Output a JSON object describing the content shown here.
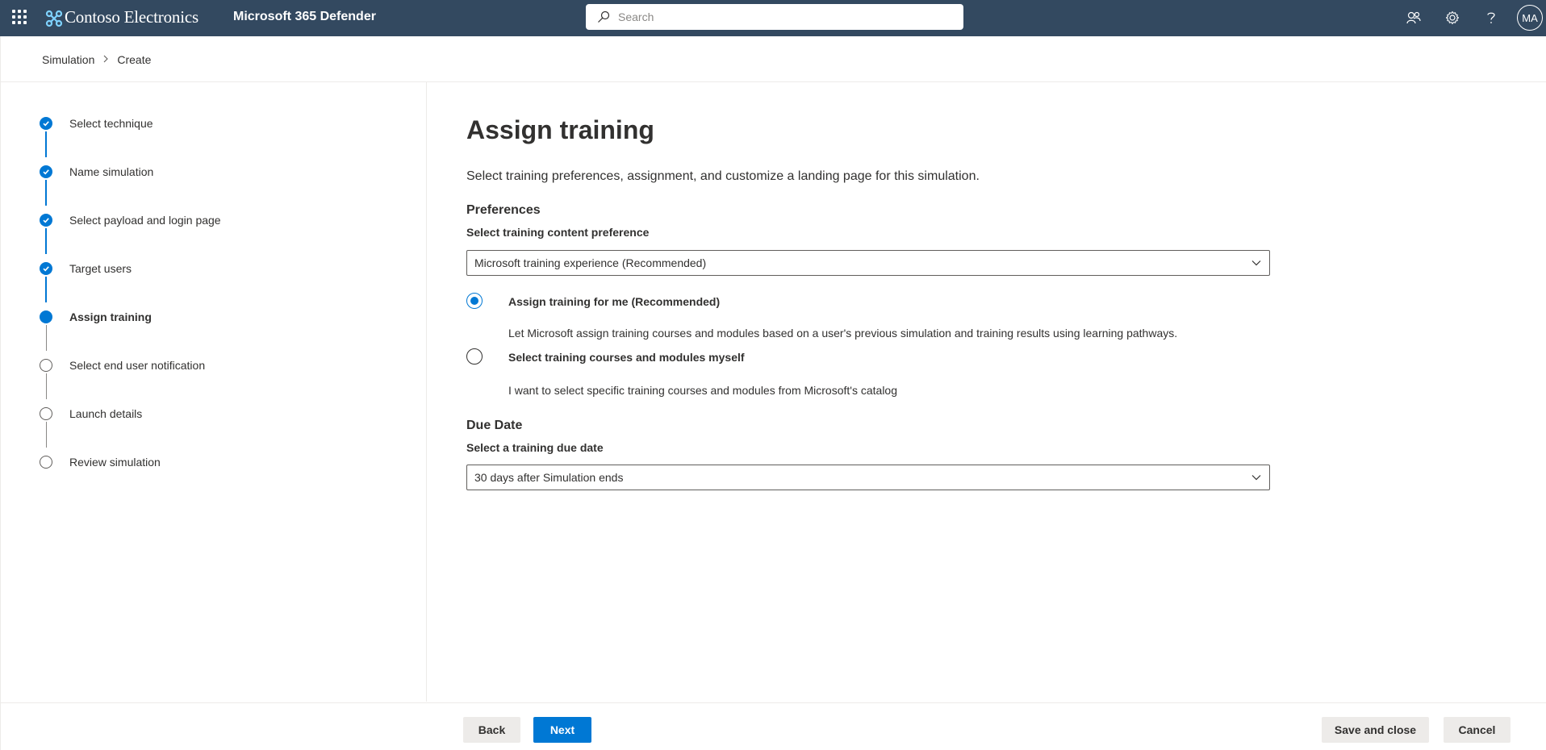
{
  "header": {
    "brand_name": "Contoso Electronics",
    "product_name": "Microsoft 365 Defender",
    "search_placeholder": "Search",
    "avatar_initials": "MA",
    "icons": [
      "app-launcher-icon",
      "community-icon",
      "gear-icon",
      "help-icon"
    ]
  },
  "breadcrumb": {
    "items": [
      "Simulation",
      "Create"
    ]
  },
  "steps": [
    {
      "label": "Select technique",
      "state": "done"
    },
    {
      "label": "Name simulation",
      "state": "done"
    },
    {
      "label": "Select payload and login page",
      "state": "done"
    },
    {
      "label": "Target users",
      "state": "done"
    },
    {
      "label": "Assign training",
      "state": "current"
    },
    {
      "label": "Select end user notification",
      "state": "todo"
    },
    {
      "label": "Launch details",
      "state": "todo"
    },
    {
      "label": "Review simulation",
      "state": "todo"
    }
  ],
  "main": {
    "title": "Assign training",
    "subtitle": "Select training preferences, assignment, and customize a landing page for this simulation.",
    "preferences": {
      "heading": "Preferences",
      "content_label": "Select training content preference",
      "content_value": "Microsoft training experience (Recommended)"
    },
    "options": [
      {
        "label": "Assign training for me (Recommended)",
        "description": "Let Microsoft assign training courses and modules based on a user's previous simulation and training results using learning pathways.",
        "selected": true
      },
      {
        "label": "Select training courses and modules myself",
        "description": "I want to select specific training courses and modules from Microsoft's catalog",
        "selected": false
      }
    ],
    "due_date": {
      "heading": "Due Date",
      "label": "Select a training due date",
      "value": "30 days after Simulation ends"
    }
  },
  "footer": {
    "back_label": "Back",
    "next_label": "Next",
    "save_close_label": "Save and close",
    "cancel_label": "Cancel"
  },
  "colors": {
    "topbar": "#334960",
    "accent": "#0078d4",
    "button_secondary": "#edebe9"
  }
}
